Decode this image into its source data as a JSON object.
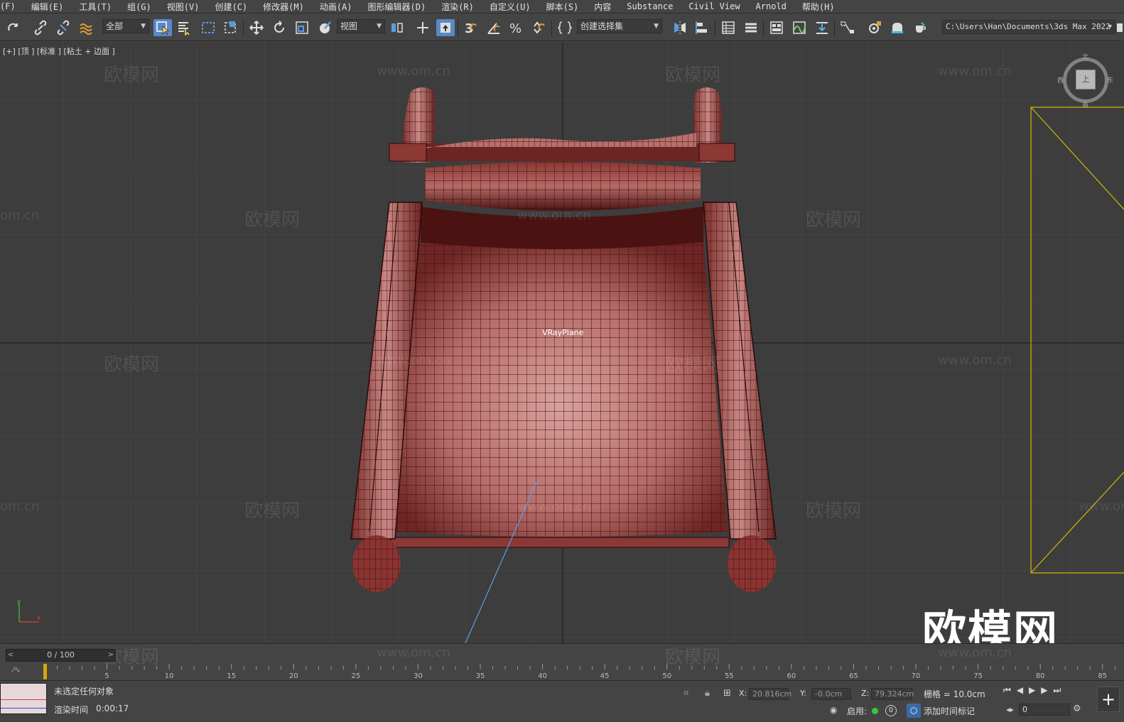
{
  "menu": [
    "(F)",
    "编辑(E)",
    "工具(T)",
    "组(G)",
    "视图(V)",
    "创建(C)",
    "修改器(M)",
    "动画(A)",
    "图形编辑器(D)",
    "渲染(R)",
    "自定义(U)",
    "脚本(S)",
    "内容",
    "Substance",
    "Civil View",
    "Arnold",
    "帮助(H)"
  ],
  "toolbar": {
    "selection_filter": "全部",
    "ref_coord": "视图",
    "snap_angle": "3",
    "named_selection": "创建选择集",
    "project_path": "C:\\Users\\Han\\Documents\\3ds Max 2022"
  },
  "viewport": {
    "label": "[+] [顶 ] [标准 ] [粘土 + 边面 ]",
    "object_label": "VRayPlane",
    "viewcube": {
      "n": "北",
      "w": "西",
      "e": "东",
      "s": "南",
      "face": "上"
    },
    "watermark_cn": "欧模网",
    "watermark_url": "www.om.cn",
    "watermark_url_short": "om.cn",
    "big_watermark": "欧模网"
  },
  "timeline": {
    "frame": "0 / 100",
    "ticks": [
      "5",
      "10",
      "15",
      "20",
      "25",
      "30",
      "35",
      "40",
      "45",
      "50",
      "55",
      "60",
      "65",
      "70",
      "75",
      "80",
      "85"
    ]
  },
  "status": {
    "selection": "未选定任何对象",
    "render_time_label": "渲染时间",
    "render_time": "0:00:17",
    "x_label": "X:",
    "x": "20.816cm",
    "y_label": "Y:",
    "y": "-0.0cm",
    "z_label": "Z:",
    "z": "79.324cm",
    "grid": "栅格 = 10.0cm",
    "enable_label": "启用:",
    "enable_count": "0",
    "add_time_tag": "添加时间标记",
    "frame_field": "0"
  },
  "colors": {
    "accent": "#5a88c8",
    "mesh": "#c07a78",
    "wire": "#3a0e0e",
    "selection": "#d4b800"
  }
}
